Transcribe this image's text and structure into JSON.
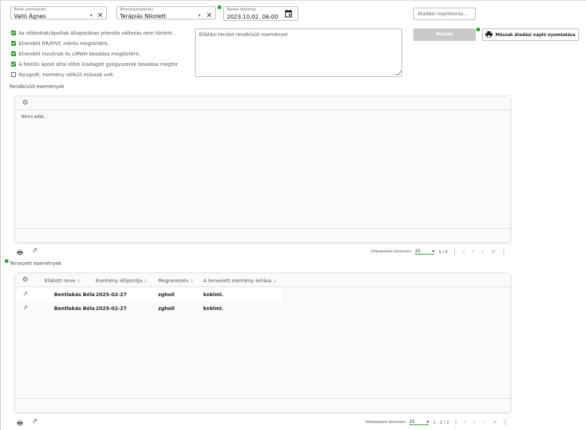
{
  "handover": {
    "giver": {
      "label": "Átadó személy(ek)",
      "value": "Valló Ágnes"
    },
    "receiver": {
      "label": "Átvevőszemély(ek)",
      "value": "Terápiás Nikolett"
    },
    "datetime": {
      "label": "Átadás időpontja",
      "value": "2023.10.02. 06:00"
    },
    "log_order_placeholder": "Átadási naplósorsz..."
  },
  "checklist": [
    {
      "label": "Az ellátottak/ápoltak állapotában jelentős változás nem történt.",
      "checked": true
    },
    {
      "label": "Elrendelt RR/P/VC mérés megtörtént.",
      "checked": true
    },
    {
      "label": "Elrendelt inzulinok és LMWH beadása megtörtént.",
      "checked": true
    },
    {
      "label": "A felelős ápoló által előre kiadagolt gyógyszerek beadása megtör",
      "checked": true
    },
    {
      "label": "Nyugodt, esemény nélküli műszak volt.",
      "checked": false
    }
  ],
  "events_textarea_placeholder": "Ellátási terület rendkívüli eseményei",
  "actions": {
    "save_label": "Mentés",
    "print_label": "Műszak átadási napló nyomtatása"
  },
  "extraordinary": {
    "title": "Rendkívüli események",
    "empty_text": "Nincs adat...",
    "pager": {
      "per_page_label": "Oldalankénti tételszám:",
      "per_page": "25",
      "count": "0 / 0"
    }
  },
  "planned": {
    "title": "Tervezett események",
    "columns": [
      "Ellátott neve",
      "Esemény időpontja",
      "Megnevezés",
      "A tervezett esemény leírása"
    ],
    "rows": [
      {
        "name": "Bentlakás Béla",
        "date": "2025-02-27",
        "title": "zghoil",
        "desc": "knklml."
      },
      {
        "name": "Bentlakás Béla",
        "date": "2025-02-27",
        "title": "zghoil",
        "desc": "knklml."
      }
    ],
    "pager": {
      "per_page_label": "Oldalankénti tételszám:",
      "per_page": "25",
      "count": "1 - 2 / 2"
    }
  },
  "colors": {
    "accent": "#2a9a2a",
    "disabled": "#c9c9c9"
  }
}
